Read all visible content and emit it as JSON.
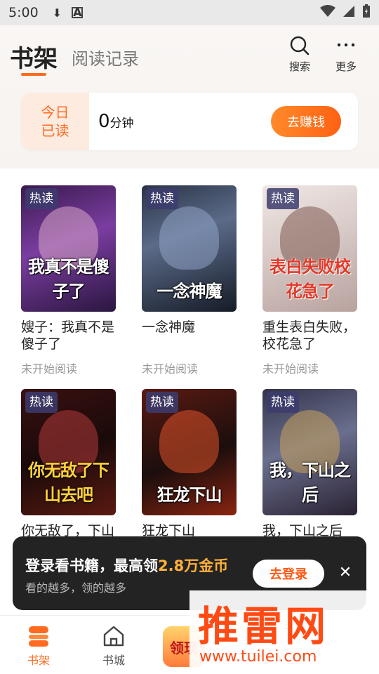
{
  "status_bar": {
    "time": "5:00"
  },
  "header": {
    "tab_shelf": "书架",
    "tab_history": "阅读记录",
    "search_label": "搜索",
    "more_label": "更多"
  },
  "today": {
    "label_line1": "今日",
    "label_line2": "已读",
    "value": "0",
    "unit": "分钟",
    "earn_button": "去赚钱"
  },
  "books": [
    {
      "tag": "热读",
      "cover_text": "我真不是傻子了",
      "title": "嫂子：我真不是傻子了",
      "status": "未开始阅读"
    },
    {
      "tag": "热读",
      "cover_text": "一念神魔",
      "title": "一念神魔",
      "status": "未开始阅读"
    },
    {
      "tag": "热读",
      "cover_text": "表白失败校花急了",
      "title": "重生表白失败，校花急了",
      "status": "未开始阅读"
    },
    {
      "tag": "热读",
      "cover_text": "你无敌了下山去吧",
      "title": "你无敌了，下山去吧",
      "status": ""
    },
    {
      "tag": "热读",
      "cover_text": "狂龙下山",
      "title": "狂龙下山",
      "status": ""
    },
    {
      "tag": "热读",
      "cover_text": "我，下山之后",
      "title": "我，下山之后",
      "status": ""
    }
  ],
  "login_banner": {
    "title_prefix": "登录看书籍，最高领",
    "title_highlight": "2.8万金币",
    "subtitle": "看的越多，领的越多",
    "button": "去登录"
  },
  "bottom_nav": {
    "shelf": "书架",
    "store": "书城",
    "reward": "领现"
  },
  "watermark": {
    "main": "推雷网",
    "url": "www.tuilei.com"
  },
  "colors": {
    "accent": "#ff6a1f",
    "banner_bg": "#232323",
    "highlight": "#ffb13b"
  }
}
